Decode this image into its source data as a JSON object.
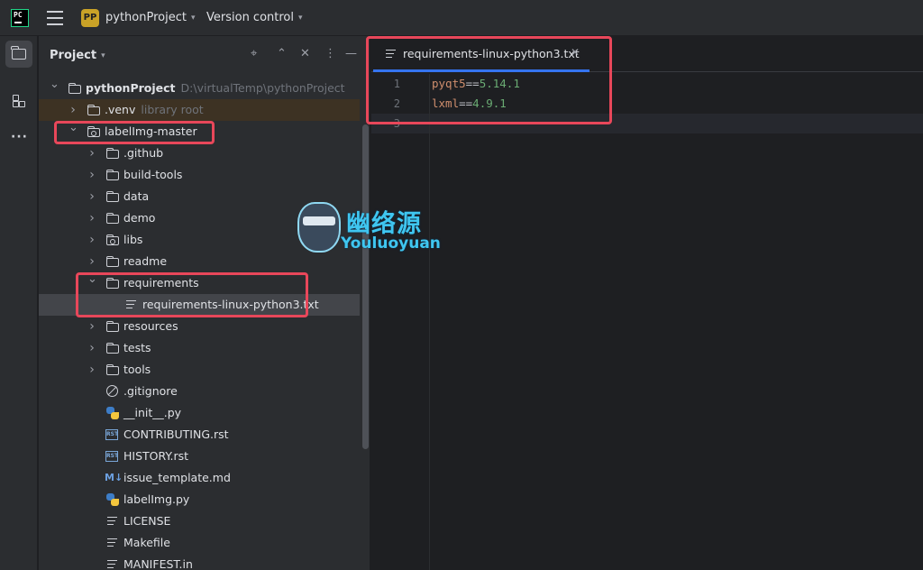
{
  "titlebar": {
    "app_logo_text": "PC",
    "project_badge": "PP",
    "project_name": "pythonProject",
    "version_control": "Version control"
  },
  "panel": {
    "title": "Project",
    "icons": [
      "crosshair-icon",
      "expand-icon",
      "collapse-icon",
      "more-vertical-icon",
      "minimize-icon"
    ]
  },
  "tree": [
    {
      "label": "pythonProject",
      "hint": "D:\\virtualTemp\\pythonProject",
      "depth": 0,
      "expanded": true,
      "icon": "folder-icon",
      "bold": true
    },
    {
      "label": ".venv",
      "hint": "library root",
      "depth": 1,
      "expanded": false,
      "icon": "folder-icon"
    },
    {
      "label": "labelImg-master",
      "depth": 1,
      "expanded": true,
      "icon": "module-folder-icon"
    },
    {
      "label": ".github",
      "depth": 2,
      "expanded": false,
      "icon": "folder-icon"
    },
    {
      "label": "build-tools",
      "depth": 2,
      "expanded": false,
      "icon": "folder-icon"
    },
    {
      "label": "data",
      "depth": 2,
      "expanded": false,
      "icon": "folder-icon"
    },
    {
      "label": "demo",
      "depth": 2,
      "expanded": false,
      "icon": "folder-icon"
    },
    {
      "label": "libs",
      "depth": 2,
      "expanded": false,
      "icon": "module-folder-icon"
    },
    {
      "label": "readme",
      "depth": 2,
      "expanded": false,
      "icon": "folder-icon"
    },
    {
      "label": "requirements",
      "depth": 2,
      "expanded": true,
      "icon": "folder-icon"
    },
    {
      "label": "requirements-linux-python3.txt",
      "depth": 3,
      "icon": "text-file-icon",
      "selected": true
    },
    {
      "label": "resources",
      "depth": 2,
      "expanded": false,
      "icon": "folder-icon"
    },
    {
      "label": "tests",
      "depth": 2,
      "expanded": false,
      "icon": "folder-icon"
    },
    {
      "label": "tools",
      "depth": 2,
      "expanded": false,
      "icon": "folder-icon"
    },
    {
      "label": ".gitignore",
      "depth": 2,
      "icon": "ignore-file-icon"
    },
    {
      "label": "__init__.py",
      "depth": 2,
      "icon": "python-file-icon"
    },
    {
      "label": "CONTRIBUTING.rst",
      "depth": 2,
      "icon": "rst-file-icon"
    },
    {
      "label": "HISTORY.rst",
      "depth": 2,
      "icon": "rst-file-icon"
    },
    {
      "label": "issue_template.md",
      "depth": 2,
      "icon": "markdown-file-icon"
    },
    {
      "label": "labelImg.py",
      "depth": 2,
      "icon": "python-file-icon"
    },
    {
      "label": "LICENSE",
      "depth": 2,
      "icon": "text-file-icon"
    },
    {
      "label": "Makefile",
      "depth": 2,
      "icon": "text-file-icon"
    },
    {
      "label": "MANIFEST.in",
      "depth": 2,
      "icon": "text-file-icon"
    }
  ],
  "editor": {
    "tab_label": "requirements-linux-python3.txt",
    "line_numbers": [
      "1",
      "2",
      "3"
    ],
    "lines": [
      {
        "key": "pyqt5",
        "op": "==",
        "ver": "5.14.1"
      },
      {
        "key": "lxml",
        "op": "==",
        "ver": "4.9.1"
      },
      {
        "key": "",
        "op": "",
        "ver": ""
      }
    ]
  },
  "watermark": {
    "cn": "幽络源",
    "en": "Youluoyuan"
  },
  "colors": {
    "highlight": "#e8475a",
    "accent": "#3574f0",
    "project_badge": "#c9a227"
  }
}
